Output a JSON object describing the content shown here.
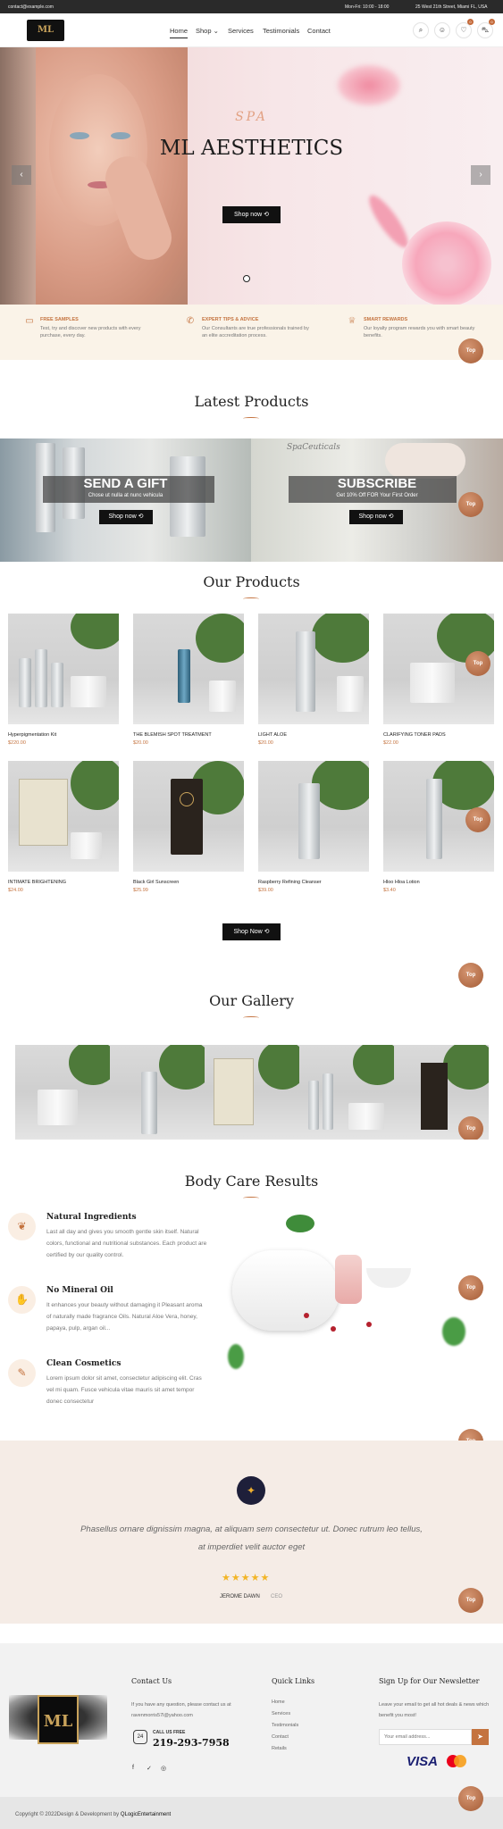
{
  "topbar": {
    "email": "contact@example.com",
    "hours": "Mon-Fri: 10:00 - 18:00",
    "address": "25 West 21th Street, Miami FL, USA"
  },
  "nav": {
    "logo": "ML",
    "items": [
      "Home",
      "Shop",
      "Services",
      "Testimonials",
      "Contact"
    ],
    "cart_count": "0",
    "wish_count": "0"
  },
  "hero": {
    "subtitle": "SPA",
    "title": "ML AESTHETICS",
    "button": "Shop now"
  },
  "features": [
    {
      "title": "FREE SAMPLES",
      "desc": "Test, try and discover new products with every purchase, every day."
    },
    {
      "title": "EXPERT TIPS & ADVICE",
      "desc": "Our Consultants are true professionals trained by an elite accreditation process."
    },
    {
      "title": "SMART REWARDS",
      "desc": "Our loyalty program rewards you with smart beauty benefits."
    }
  ],
  "top_label": "Top",
  "latest": {
    "title": "Latest Products"
  },
  "promos": [
    {
      "title": "SEND A GIFT",
      "sub": "Chose ut nulla at nunc vehicula",
      "button": "Shop now",
      "label": ""
    },
    {
      "title": "SUBSCRIBE",
      "sub": "Get 10% Off FOR Your First Order",
      "button": "Shop now",
      "label": "SpaCeuticals"
    }
  ],
  "our_products": {
    "title": "Our Products",
    "button": "Shop Now",
    "items": [
      {
        "name": "Hyperpigmentation Kit",
        "price": "$220.00"
      },
      {
        "name": "THE BLEMISH SPOT TREATMENT",
        "price": "$20.00"
      },
      {
        "name": "LIGHT ALOE",
        "price": "$20.00"
      },
      {
        "name": "CLARIFYING TONER PADS",
        "price": "$22.00"
      },
      {
        "name": "INTIMATE BRIGHTENING",
        "price": "$24.00"
      },
      {
        "name": "Black Girl Sunscreen",
        "price": "$25.99"
      },
      {
        "name": "Raspberry Refining Cleanser",
        "price": "$39.00"
      },
      {
        "name": "Hloo Hloa Lotion",
        "price": "$3.40"
      }
    ]
  },
  "gallery": {
    "title": "Our Gallery"
  },
  "body_care": {
    "title": "Body Care Results",
    "items": [
      {
        "title": "Natural Ingredients",
        "desc": "Last all day and gives you smooth gentle skin itself. Natural colors, functional and nutritional substances. Each product are certified by our quality control."
      },
      {
        "title": "No Mineral Oil",
        "desc": "It enhances your beauty without damaging it Pleasant aroma of naturally made fragrance Oils. Natural Aloe Vera, honey, papaya, pulp, argan oil..."
      },
      {
        "title": "Clean Cosmetics",
        "desc": "Lorem ipsum dolor sit amet, consectetur adipiscing elit. Cras vel mi quam. Fusce vehicula vitae mauris sit amet tempor donec consectetur"
      }
    ]
  },
  "testimonial": {
    "quote": "Phasellus ornare dignissim magna, at aliquam sem consectetur ut. Donec rutrum leo tellus, at imperdiet velit auctor eget",
    "name": "JEROME DAWN",
    "role": "CEO"
  },
  "footer": {
    "contact_title": "Contact Us",
    "contact_text": "If you have any question, please contact us at ravenmorris57l@yahoo.com",
    "call_label": "CALL US FREE",
    "phone": "219-293-7958",
    "call_icon_text": "24",
    "links_title": "Quick Links",
    "links": [
      "Home",
      "Services",
      "Testimonials",
      "Contact",
      "Retails"
    ],
    "news_title": "Sign Up for Our Newsletter",
    "news_text": "Leave your email to get all hot deals & news which benefit you most!",
    "email_placeholder": "Your email address...",
    "logo_text": "ML"
  },
  "copyright": {
    "text": "Copyright © 2022Design & Development by ",
    "brand": "QLogicEntertainment"
  },
  "colors": {
    "accent": "#c4733f",
    "dark": "#111111"
  }
}
